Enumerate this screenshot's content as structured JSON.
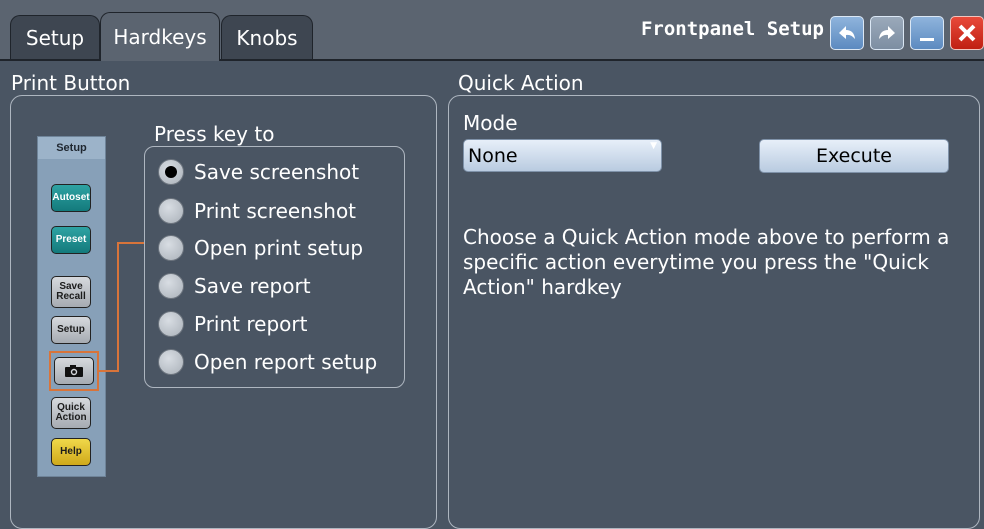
{
  "tabs": [
    {
      "label": "Setup",
      "active": false
    },
    {
      "label": "Hardkeys",
      "active": true
    },
    {
      "label": "Knobs",
      "active": false
    }
  ],
  "window": {
    "title": "Frontpanel Setup",
    "buttons": [
      "undo-icon",
      "redo-icon",
      "minimize-icon",
      "close-icon"
    ]
  },
  "print_button": {
    "section_label": "Print Button",
    "hardkey_strip": {
      "title": "Setup",
      "keys": [
        "Autoset",
        "Preset",
        "Save\nRecall",
        "Setup",
        "camera-icon",
        "Quick\nAction",
        "Help"
      ]
    },
    "press_key_label": "Press key to",
    "options": [
      {
        "label": "Save screenshot",
        "checked": true
      },
      {
        "label": "Print screenshot",
        "checked": false
      },
      {
        "label": "Open print setup",
        "checked": false
      },
      {
        "label": "Save report",
        "checked": false
      },
      {
        "label": "Print report",
        "checked": false
      },
      {
        "label": "Open report setup",
        "checked": false
      }
    ]
  },
  "quick_action": {
    "section_label": "Quick Action",
    "mode_label": "Mode",
    "mode_value": "None",
    "execute_label": "Execute",
    "description": "Choose a Quick Action mode above to perform a specific action everytime you press the \"Quick Action\" hardkey"
  },
  "colors": {
    "background": "#4a5563",
    "accent_orange": "#d8743a",
    "key_teal": "#1f8e90",
    "key_yellow": "#e2c230",
    "close_red": "#d9301f"
  }
}
